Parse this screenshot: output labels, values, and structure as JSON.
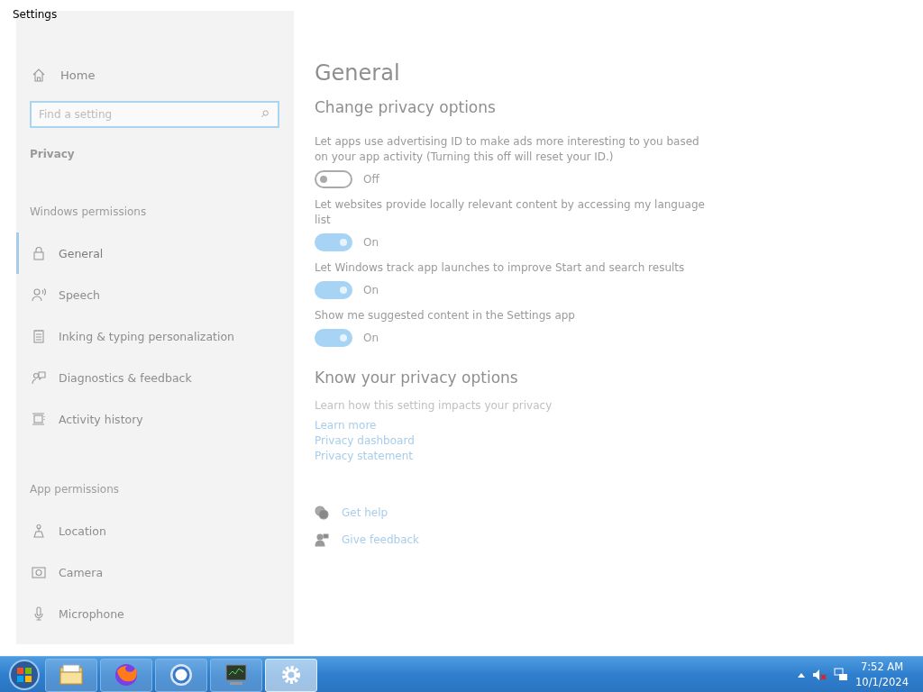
{
  "window": {
    "title": "Settings"
  },
  "sidebar": {
    "home": "Home",
    "search": {
      "placeholder": "Find a setting"
    },
    "section": "Privacy",
    "groups": [
      {
        "heading": "Windows permissions",
        "items": [
          {
            "label": "General",
            "selected": true
          },
          {
            "label": "Speech",
            "selected": false
          },
          {
            "label": "Inking & typing personalization",
            "selected": false
          },
          {
            "label": "Diagnostics & feedback",
            "selected": false
          },
          {
            "label": "Activity history",
            "selected": false
          }
        ]
      },
      {
        "heading": "App permissions",
        "items": [
          {
            "label": "Location",
            "selected": false
          },
          {
            "label": "Camera",
            "selected": false
          },
          {
            "label": "Microphone",
            "selected": false
          }
        ]
      }
    ]
  },
  "content": {
    "title": "General",
    "subtitle": "Change privacy options",
    "settings": [
      {
        "description": "Let apps use advertising ID to make ads more interesting to you based on your app activity (Turning this off will reset your ID.)",
        "on": false,
        "state_label": "Off"
      },
      {
        "description": "Let websites provide locally relevant content by accessing my language list",
        "on": true,
        "state_label": "On"
      },
      {
        "description": "Let Windows track app launches to improve Start and search results",
        "on": true,
        "state_label": "On"
      },
      {
        "description": "Show me suggested content in the Settings app",
        "on": true,
        "state_label": "On"
      }
    ],
    "know": {
      "heading": "Know your privacy options",
      "description": "Learn how this setting impacts your privacy",
      "links": [
        "Learn more",
        "Privacy dashboard",
        "Privacy statement"
      ]
    },
    "help": [
      {
        "label": "Get help"
      },
      {
        "label": "Give feedback"
      }
    ]
  },
  "taskbar": {
    "apps": [
      {
        "selected": false
      },
      {
        "selected": false
      },
      {
        "selected": false
      },
      {
        "selected": false
      },
      {
        "selected": true
      }
    ],
    "time": "7:52 AM",
    "date": "10/1/2024"
  }
}
